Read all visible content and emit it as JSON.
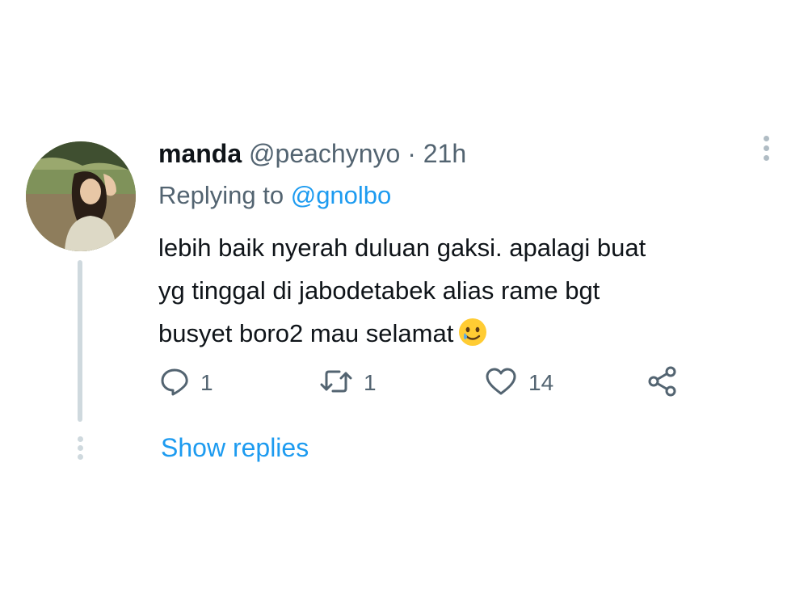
{
  "tweet": {
    "display_name": "manda",
    "handle": "@peachynyo",
    "separator": "·",
    "time": "21h",
    "replying_prefix": "Replying to",
    "replying_to": "@gnolbo",
    "lines": [
      "lebih baik nyerah duluan gaksi. apalagi buat",
      "yg tinggal di jabodetabek alias rame bgt",
      "busyet boro2 mau selamat"
    ],
    "emoji": "smiling-face-with-tear",
    "actions": {
      "reply_count": "1",
      "retweet_count": "1",
      "like_count": "14"
    }
  },
  "show_replies_label": "Show replies",
  "icons": {
    "more": "more-vertical-icon",
    "reply": "reply-icon",
    "retweet": "retweet-icon",
    "like": "heart-icon",
    "share": "share-icon"
  },
  "colors": {
    "link": "#1d9bf0",
    "secondary_text": "#536471",
    "primary_text": "#0f1419",
    "thread_line": "#cfd9de"
  }
}
